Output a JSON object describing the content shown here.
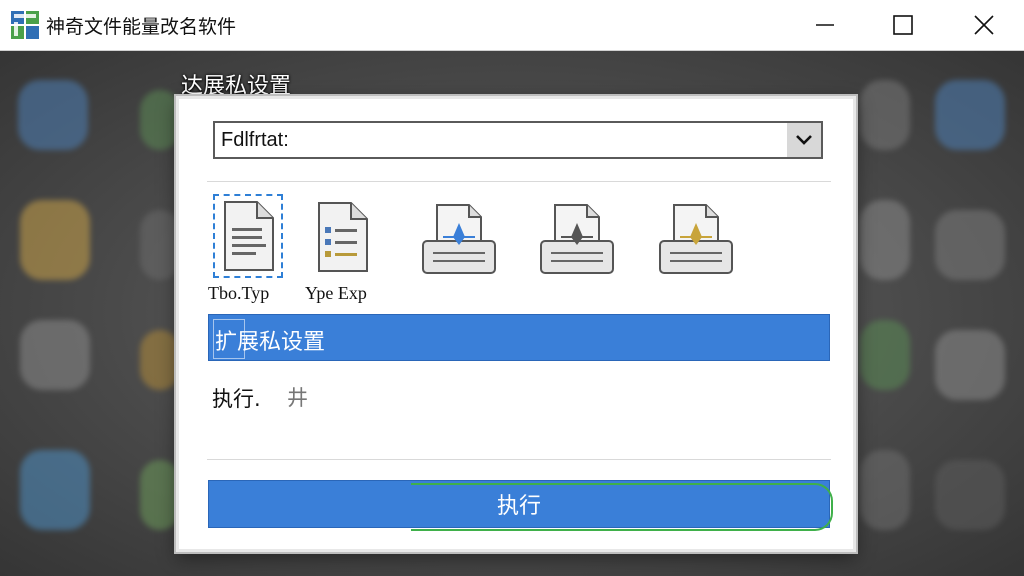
{
  "window": {
    "title": "神奇文件能量改名软件",
    "minimize_icon": "minimize-icon",
    "maximize_icon": "maximize-icon",
    "close_icon": "close-icon"
  },
  "dialog": {
    "title": "达展私设置",
    "format_select": {
      "value": "Fdlfrtat:"
    },
    "file_types": [
      {
        "icon": "document-text-icon",
        "label": "Tbo.Typ",
        "selected": true
      },
      {
        "icon": "document-list-icon",
        "label": "Ype Exp",
        "selected": false
      },
      {
        "icon": "printer-blue-icon",
        "label": "",
        "selected": false
      },
      {
        "icon": "printer-gray-icon",
        "label": "",
        "selected": false
      },
      {
        "icon": "printer-gold-icon",
        "label": "",
        "selected": false
      }
    ],
    "highlighted_item": "扩展私设置",
    "status_text": "执行.",
    "status_icon": "井",
    "execute_label": "执行"
  },
  "colors": {
    "accent": "#3a7fd8",
    "green_accent": "#3fb04a",
    "title_bar": "#ffffff",
    "backdrop": "#4a4a4a"
  }
}
